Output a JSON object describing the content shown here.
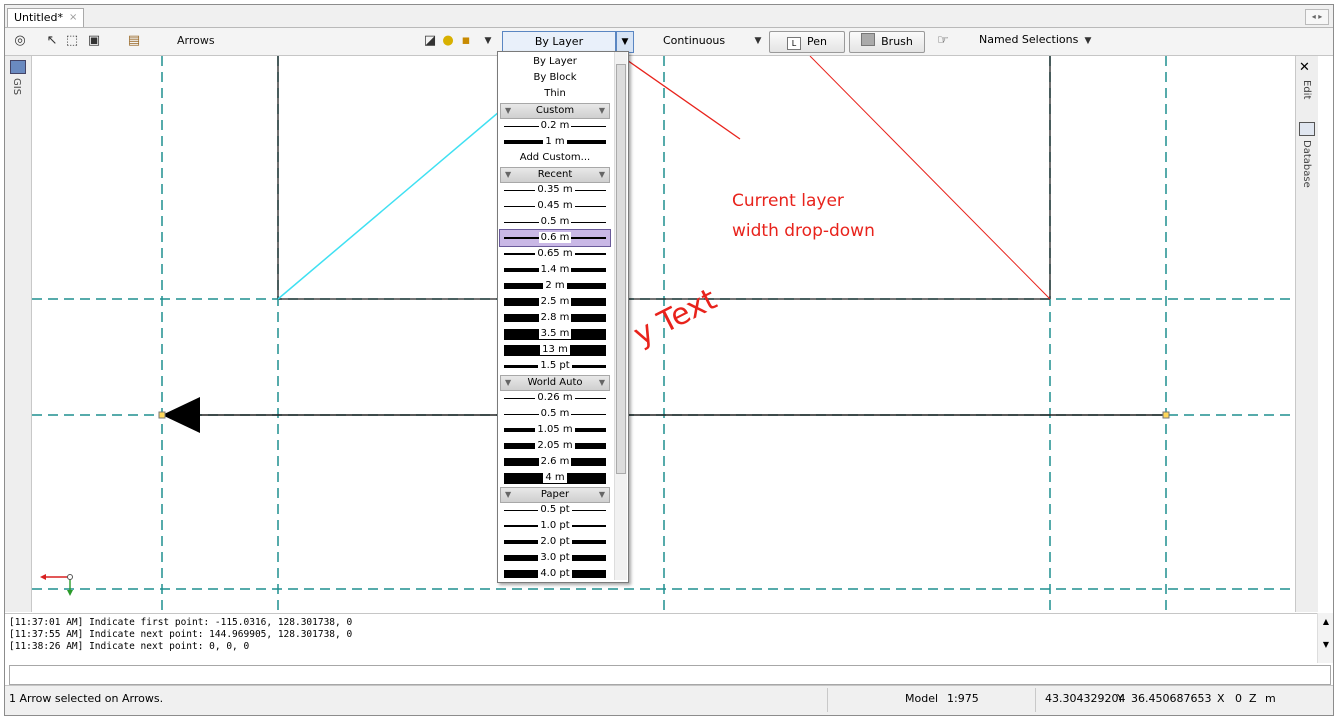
{
  "tab": {
    "title": "Untitled*",
    "close": "×"
  },
  "toolbar": {
    "layer_name": "Arrows",
    "width_combo": "By Layer",
    "line_type": "Continuous",
    "pen_key": "L",
    "pen": "Pen",
    "brush": "Brush",
    "named_selections": "Named Selections"
  },
  "sidebar_left": {
    "gis": "GIS"
  },
  "sidebar_right": {
    "edit": "Edit",
    "database": "Database"
  },
  "dropdown": {
    "top_items": [
      "By Layer",
      "By Block",
      "Thin"
    ],
    "custom_header": "Custom",
    "custom_items": [
      "0.2 m",
      "1 m"
    ],
    "add_custom": "Add Custom...",
    "recent_header": "Recent",
    "recent_items": [
      "0.35 m",
      "0.45 m",
      "0.5 m",
      "0.6 m",
      "0.65 m",
      "1.4 m",
      "2 m",
      "2.5 m",
      "2.8 m",
      "3.5 m",
      "13 m",
      "1.5 pt"
    ],
    "world_header": "World Auto",
    "world_items": [
      "0.26 m",
      "0.5 m",
      "1.05 m",
      "2.05 m",
      "2.6 m",
      "4 m"
    ],
    "paper_header": "Paper",
    "paper_items": [
      "0.5 pt",
      "1.0 pt",
      "2.0 pt",
      "3.0 pt",
      "4.0 pt"
    ],
    "selected": "0.6 m"
  },
  "annotation": {
    "line1": "Current layer",
    "line2": "width drop-down"
  },
  "canvas_text": "y Text",
  "log": [
    "[11:37:01 AM] Indicate first point: -115.0316, 128.301738, 0",
    "[11:37:55 AM] Indicate next point: 144.969905, 128.301738, 0",
    "[11:38:26 AM] Indicate next point: 0, 0, 0"
  ],
  "status": {
    "message": "1 Arrow selected on Arrows.",
    "model": "Model",
    "scale": "1:975",
    "y_value": "43.304329204",
    "y_label": "Y",
    "x_value": "36.450687653",
    "x_label": "X",
    "z_value": "0",
    "z_label": "Z",
    "unit": "m"
  },
  "colors": {
    "annotation": "#e8231c",
    "guide": "#1f8f8f",
    "cyan_line": "#3fe0f2",
    "selection": "#c9b8e6"
  }
}
